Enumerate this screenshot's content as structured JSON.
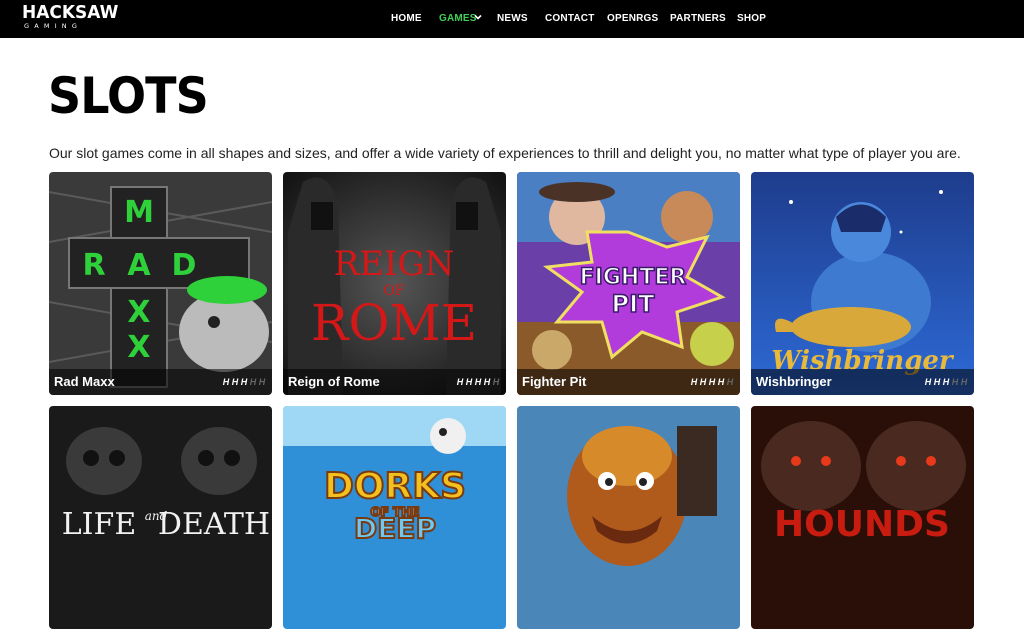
{
  "header": {
    "logo_top": "HACKSAW",
    "logo_bottom": "GAMING",
    "nav": [
      {
        "label": "HOME",
        "active": false
      },
      {
        "label": "GAMES",
        "active": true,
        "has_dropdown": true
      },
      {
        "label": "NEWS",
        "active": false
      },
      {
        "label": "CONTACT",
        "active": false
      },
      {
        "label": "OPENRGS",
        "active": false
      },
      {
        "label": "PARTNERS",
        "active": false
      },
      {
        "label": "SHOP",
        "active": false
      }
    ]
  },
  "page": {
    "title": "SLOTS",
    "description": "Our slot games come in all shapes and sizes, and offer a wide variety of experiences to thrill and delight you, no matter what type of player you are."
  },
  "games": [
    {
      "name": "Rad Maxx",
      "art_text": [
        "M",
        "R",
        "A",
        "D",
        "X",
        "X"
      ],
      "rating": 3
    },
    {
      "name": "Reign of Rome",
      "art_text": [
        "REIGN",
        "OF",
        "ROME"
      ],
      "rating": 4
    },
    {
      "name": "Fighter Pit",
      "art_text": [
        "FIGHTER",
        "PIT"
      ],
      "rating": 4
    },
    {
      "name": "Wishbringer",
      "art_text": [
        "Wishbringer"
      ],
      "rating": 3
    },
    {
      "name": "",
      "art_text": [
        "LIFE",
        "and",
        "DEATH"
      ],
      "rating": 0
    },
    {
      "name": "",
      "art_text": [
        "DORKS",
        "OF THE",
        "DEEP"
      ],
      "rating": 0
    },
    {
      "name": "",
      "art_text": [],
      "rating": 0
    },
    {
      "name": "",
      "art_text": [
        "HOUNDS"
      ],
      "rating": 0
    }
  ],
  "colors": {
    "accent_green": "#3fcf5a",
    "topbar": "#000000"
  }
}
